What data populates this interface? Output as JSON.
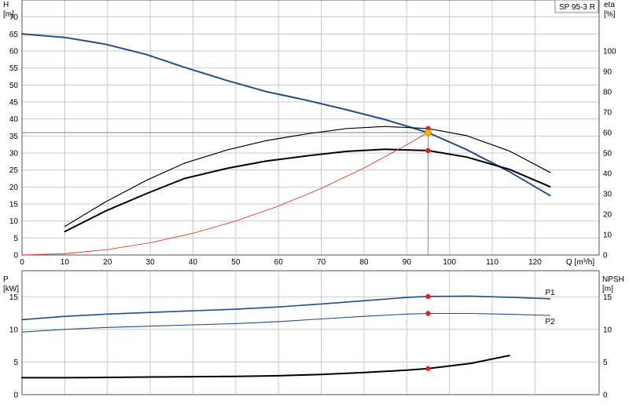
{
  "model_label": "SP 95-3 R",
  "colors": {
    "blue": "#1f4e8c",
    "black": "#000000",
    "red": "#e02020",
    "grid": "#c8c8c8",
    "yellow": "#f0c000"
  },
  "chart_data": [
    {
      "type": "line",
      "name": "top",
      "xlabel": "Q [m³/h]",
      "ylabel_left_lines": [
        "H",
        "[m]"
      ],
      "ylabel_right_lines": [
        "eta",
        "[%]"
      ],
      "xlim": [
        0,
        135
      ],
      "ylim_left": [
        0,
        75
      ],
      "ylim_right": [
        0,
        125
      ],
      "x_ticks": [
        0,
        10,
        20,
        30,
        40,
        50,
        60,
        70,
        80,
        90,
        100,
        110,
        120
      ],
      "y_left_ticks": [
        0,
        5,
        10,
        15,
        20,
        25,
        30,
        35,
        40,
        45,
        50,
        55,
        60,
        65,
        70
      ],
      "y_right_ticks": [
        0,
        10,
        20,
        30,
        40,
        50,
        60,
        70,
        80,
        90,
        100
      ],
      "grid": true,
      "series": [
        {
          "key": "H",
          "axis": "left",
          "color": "#1f4e8c",
          "width": 2,
          "x": [
            0,
            10,
            19.5,
            29,
            38,
            48,
            57,
            67,
            76,
            85,
            95,
            104,
            114,
            123.5
          ],
          "y": [
            65,
            64,
            62,
            59,
            55.2,
            51.3,
            48.1,
            45.4,
            42.7,
            39.8,
            36,
            31,
            24.5,
            17.5
          ]
        },
        {
          "key": "eta_thin",
          "axis": "right",
          "color": "#000000",
          "width": 1.2,
          "x": [
            10,
            19.5,
            29,
            38,
            48,
            57,
            67,
            76,
            85,
            95,
            104,
            114,
            123.5
          ],
          "y": [
            14,
            26,
            36.5,
            45,
            51.5,
            56,
            59.5,
            62,
            63,
            62,
            58.5,
            51,
            40.5
          ]
        },
        {
          "key": "eta_thick",
          "axis": "right",
          "color": "#000000",
          "width": 2,
          "x": [
            10,
            19.5,
            29,
            38,
            48,
            57,
            67,
            76,
            85,
            95,
            104,
            114,
            123.5
          ],
          "y": [
            11.5,
            21.5,
            30,
            37.5,
            42.5,
            46,
            48.7,
            50.8,
            51.8,
            51.2,
            48,
            42,
            33.5
          ]
        },
        {
          "key": "system_curve",
          "axis": "left",
          "color": "#e02020",
          "width": 0.8,
          "x": [
            0,
            10,
            20,
            30,
            40,
            50,
            60,
            70,
            80,
            90,
            95
          ],
          "y": [
            0,
            0.4,
            1.6,
            3.6,
            6.4,
            10,
            14.4,
            19.6,
            25.6,
            32.4,
            36.1
          ]
        }
      ],
      "guides": {
        "duty_q": 95,
        "duty_h": 36
      },
      "markers": [
        {
          "axis": "right",
          "x": 95,
          "y": 62,
          "color": "#e02020"
        },
        {
          "axis": "right",
          "x": 95,
          "y": 51.2,
          "color": "#e02020"
        },
        {
          "axis": "left",
          "x": 95,
          "y": 36,
          "color": "#f0c000"
        }
      ]
    },
    {
      "type": "line",
      "name": "bottom",
      "ylabel_left_lines": [
        "P",
        "[kW]"
      ],
      "ylabel_right_lines": [
        "NPSH",
        "[m]"
      ],
      "xlim": [
        0,
        135
      ],
      "ylim_left": [
        0,
        19
      ],
      "ylim_right": [
        0,
        19
      ],
      "x_ticks": [
        0,
        10,
        20,
        30,
        40,
        50,
        60,
        70,
        80,
        90,
        100,
        110,
        120
      ],
      "y_left_ticks": [
        0,
        5,
        10,
        15
      ],
      "y_right_ticks": [
        0,
        5,
        10,
        15
      ],
      "grid": true,
      "series": [
        {
          "key": "P1",
          "name": "P1",
          "axis": "left",
          "color": "#1f4e8c",
          "width": 1.6,
          "x": [
            0,
            10,
            20,
            30,
            40,
            50,
            60,
            70,
            80,
            90,
            95,
            105,
            115,
            123.5
          ],
          "y": [
            11.5,
            12,
            12.35,
            12.6,
            12.85,
            13.1,
            13.45,
            13.9,
            14.4,
            14.9,
            15.05,
            15.1,
            14.9,
            14.7
          ]
        },
        {
          "key": "P2",
          "name": "P2",
          "axis": "left",
          "color": "#1f4e8c",
          "width": 1.1,
          "x": [
            0,
            10,
            20,
            30,
            40,
            50,
            60,
            70,
            80,
            90,
            95,
            105,
            115,
            123.5
          ],
          "y": [
            9.6,
            10,
            10.3,
            10.5,
            10.7,
            10.9,
            11.2,
            11.6,
            12,
            12.35,
            12.45,
            12.45,
            12.3,
            12.15
          ]
        },
        {
          "key": "NPSH",
          "axis": "right",
          "color": "#000000",
          "width": 2,
          "x": [
            0,
            10,
            20,
            30,
            40,
            50,
            60,
            70,
            80,
            90,
            95,
            105,
            114
          ],
          "y": [
            2.6,
            2.6,
            2.65,
            2.7,
            2.75,
            2.8,
            2.9,
            3.1,
            3.4,
            3.75,
            4,
            4.8,
            6
          ]
        }
      ],
      "markers": [
        {
          "axis": "left",
          "x": 95,
          "y": 15.05,
          "color": "#e02020"
        },
        {
          "axis": "left",
          "x": 95,
          "y": 12.45,
          "color": "#e02020"
        },
        {
          "axis": "right",
          "x": 95,
          "y": 4,
          "color": "#e02020"
        }
      ]
    }
  ]
}
